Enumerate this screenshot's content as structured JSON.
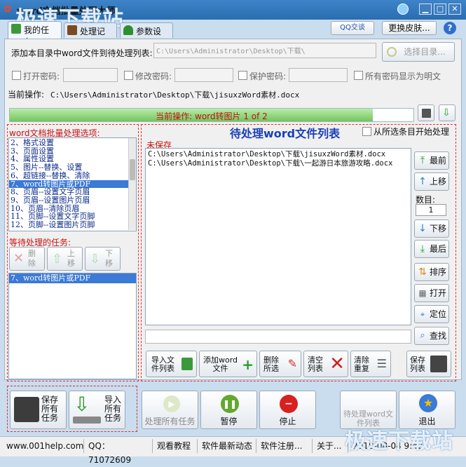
{
  "window": {
    "title": "word文档批量处理大师",
    "watermark_top": "极速下载站",
    "watermark_bottom": "极速下载站"
  },
  "header": {
    "qq_badge": "QQ交谈",
    "skin_button": "更换皮肤..."
  },
  "tabs": [
    {
      "label": "我的任务"
    },
    {
      "label": "处理记录"
    },
    {
      "label": "参数设置"
    }
  ],
  "add_dir": {
    "label": "添加本目录中word文件到待处理列表:",
    "path": "C:\\Users\\Administrator\\Desktop\\下载\\",
    "button": "选择目录..."
  },
  "passwords": {
    "open_label": "打开密码:",
    "modify_label": "修改密码:",
    "protect_label": "保护密码:",
    "show_plain_label": "所有密码显示为明文"
  },
  "current_op": {
    "label": "当前操作:",
    "value": "C:\\Users\\Administrator\\Desktop\\下载\\jisuxzWord素材.docx"
  },
  "progress": {
    "text": "当前操作: word转图片 1 of 2",
    "fraction": 0.9
  },
  "options": {
    "title": "word文档批量处理选项:",
    "items": [
      "2、格式设置",
      "3、页面设置",
      "4、属性设置",
      "5、图片--替换、设置",
      "6、超链接--替换、清除",
      "7、word转图片或PDF",
      "8、页眉--设置文字页眉",
      "9、页眉--设置图片页眉",
      "10、页眉--清除页眉",
      "11、页脚--设置文字页脚",
      "12、页脚--设置图片页脚"
    ],
    "selected_index": 5
  },
  "pending_tasks": {
    "title": "等待处理的任务:",
    "delete": "删除",
    "up": "上移",
    "down": "下移",
    "items": [
      "7、word转图片或PDF"
    ]
  },
  "file_list": {
    "title": "待处理word文件列表",
    "from_selected_label": "从所选条目开始处理",
    "unsaved": "未保存",
    "files": [
      "C:\\Users\\Administrator\\Desktop\\下载\\jisuxzWord素材.docx",
      "C:\\Users\\Administrator\\Desktop\\下载\\一起游日本旅游攻略.docx"
    ]
  },
  "side_buttons": {
    "top": "最前",
    "up": "上移",
    "count_label": "数目:",
    "count_value": "1",
    "down": "下移",
    "bottom": "最后",
    "sort": "排序",
    "open": "打开",
    "locate": "定位",
    "find": "查找"
  },
  "list_buttons": {
    "import_line1": "导入文",
    "import_line2": "件列表",
    "add_line1": "添加word",
    "add_line2": "文件",
    "delsel_line1": "删除",
    "delsel_line2": "所选",
    "clear_line1": "清空",
    "clear_line2": "列表",
    "dedupe_line1": "清除",
    "dedupe_line2": "重复",
    "save_line1": "保存",
    "save_line2": "列表"
  },
  "task_buttons": {
    "save_line1": "保存",
    "save_line2": "所有",
    "save_line3": "任务",
    "import_line1": "导入",
    "import_line2": "所有",
    "import_line3": "任务"
  },
  "action_buttons": {
    "process_all": "处理所有任务",
    "pause": "暂停",
    "stop": "停止",
    "pending_list_line1": "待处理word文",
    "pending_list_line2": "件列表",
    "exit": "退出"
  },
  "statusbar": {
    "website": "www.001help.com",
    "qq": "QQ：71072609",
    "tutorial": "观看教程",
    "news": "软件最新动态",
    "register": "软件注册...",
    "about": "关于...",
    "datetime": "2018-08-04   9:42"
  },
  "colors": {
    "titlebar": "#2a6db1",
    "accent_red": "#e03030",
    "progress_green": "#8fd47a",
    "selection_blue": "#3b7ad6",
    "heading_blue": "#1a3fb8"
  }
}
